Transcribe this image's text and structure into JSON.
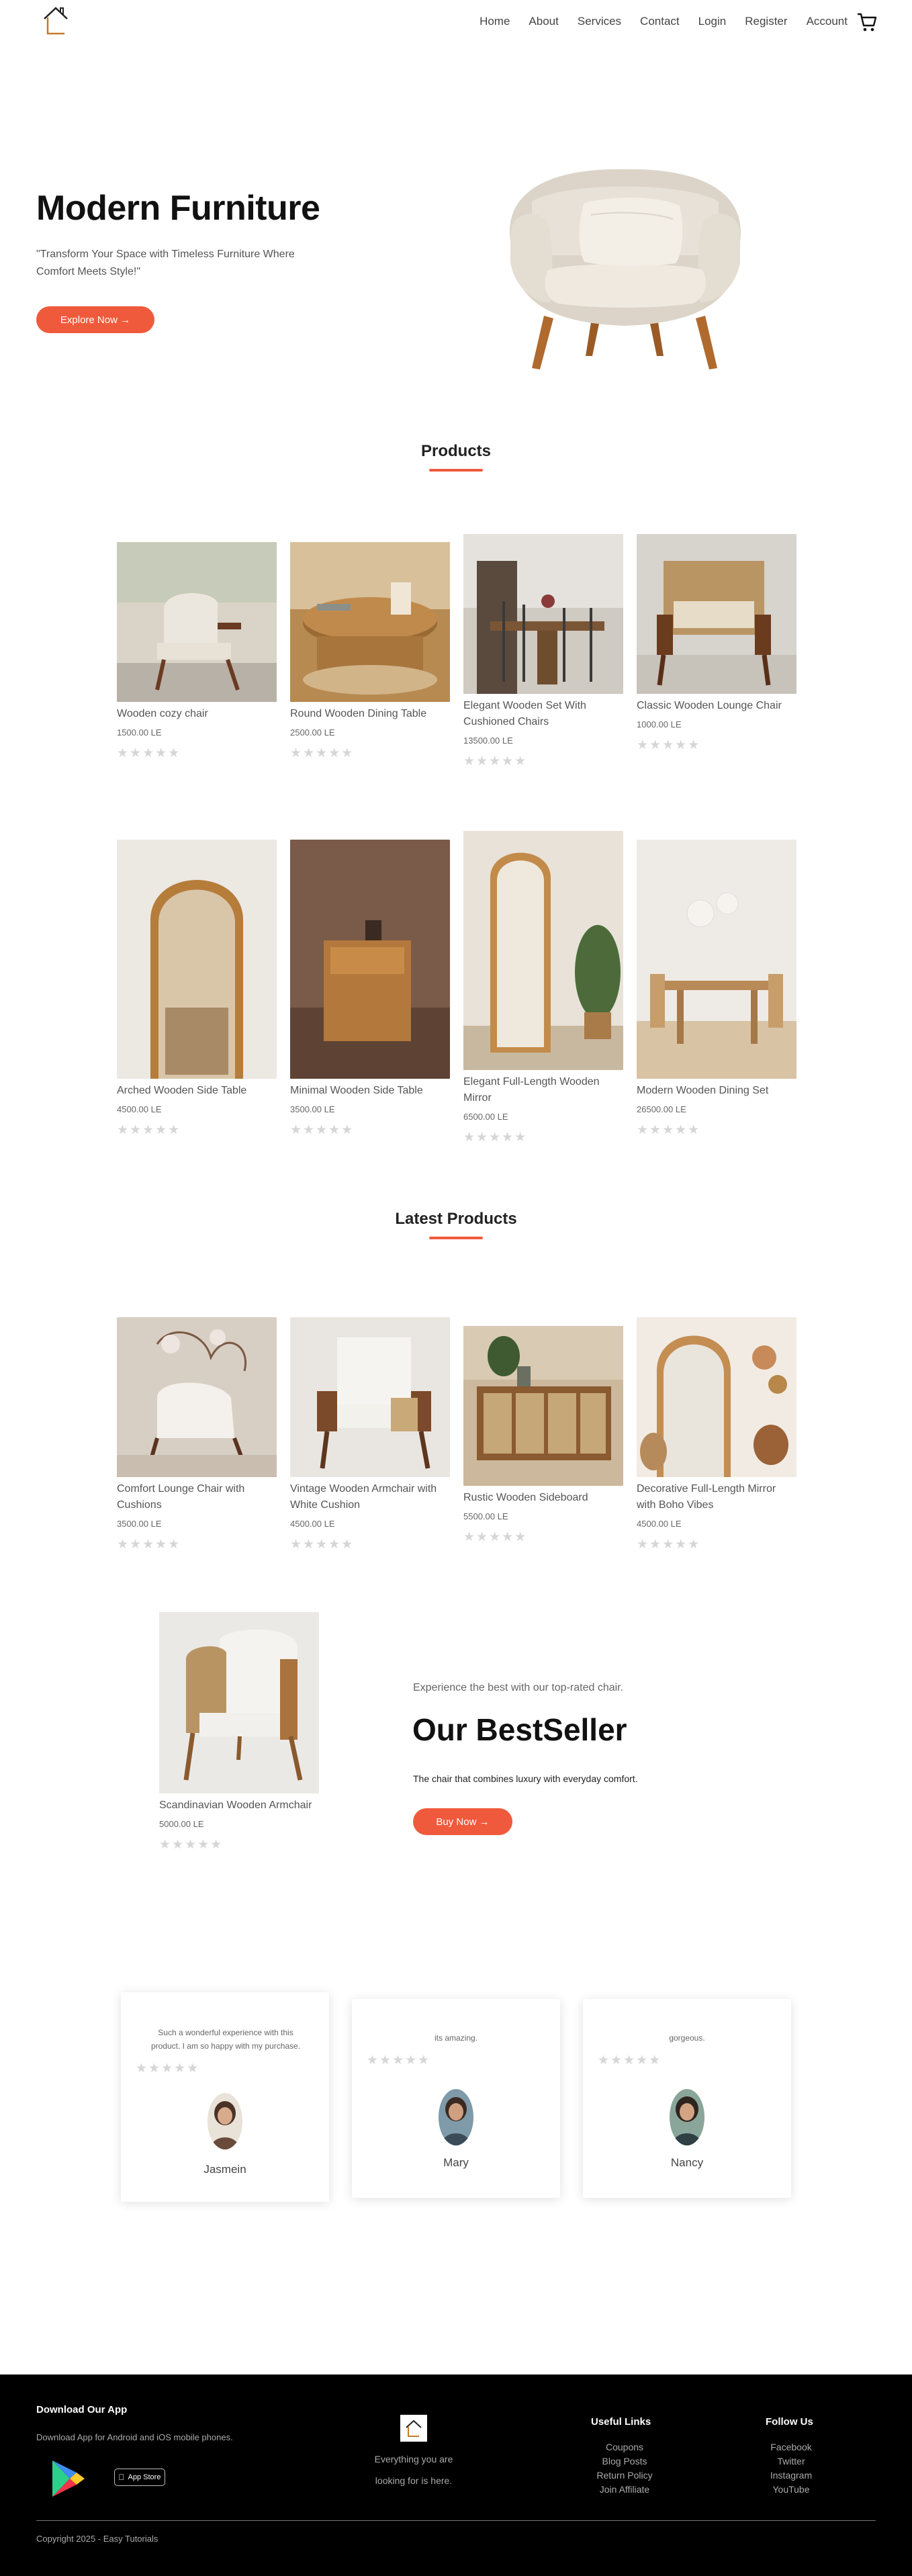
{
  "nav": {
    "items": [
      "Home",
      "About",
      "Services",
      "Contact",
      "Login",
      "Register",
      "Account"
    ],
    "logo_icon": "house-logo-icon",
    "cart_icon": "cart-icon"
  },
  "hero": {
    "title": "Modern Furniture",
    "subtitle": "\"Transform Your Space with Timeless Furniture Where Comfort Meets Style!\"",
    "button": "Explore Now →"
  },
  "products_section": {
    "title": "Products"
  },
  "products": [
    {
      "name": "Wooden cozy chair",
      "price": "1500.00 LE"
    },
    {
      "name": "Round Wooden Dining Table",
      "price": "2500.00 LE"
    },
    {
      "name": "Elegant Wooden Set With Cushioned Chairs",
      "price": "13500.00 LE"
    },
    {
      "name": "Classic Wooden Lounge Chair",
      "price": "1000.00 LE"
    },
    {
      "name": "Arched Wooden Side Table",
      "price": "4500.00 LE"
    },
    {
      "name": "Minimal Wooden Side Table",
      "price": "3500.00 LE"
    },
    {
      "name": "Elegant Full-Length Wooden Mirror",
      "price": "6500.00 LE"
    },
    {
      "name": "Modern Wooden Dining Set",
      "price": "26500.00 LE"
    }
  ],
  "latest_section": {
    "title": "Latest Products"
  },
  "latest": [
    {
      "name": "Comfort Lounge Chair with Cushions",
      "price": "3500.00 LE"
    },
    {
      "name": "Vintage Wooden Armchair with White Cushion",
      "price": "4500.00 LE"
    },
    {
      "name": "Rustic Wooden Sideboard",
      "price": "5500.00 LE"
    },
    {
      "name": "Decorative Full-Length Mirror with Boho Vibes",
      "price": "4500.00 LE"
    }
  ],
  "bestseller": {
    "product_name": "Scandinavian Wooden Armchair",
    "price": "5000.00 LE",
    "tagline": "Experience the best with our top-rated chair.",
    "title": "Our BestSeller",
    "description": "The chair that combines luxury with everyday comfort.",
    "button": "Buy Now →"
  },
  "stars": "★★★★★",
  "reviews": [
    {
      "text": "Such a wonderful experience with this product. I am so happy with my purchase.",
      "name": "Jasmein"
    },
    {
      "text": "its amazing.",
      "name": "Mary"
    },
    {
      "text": "gorgeous.",
      "name": "Nancy"
    }
  ],
  "footer": {
    "download_title": "Download Our App",
    "download_text": "Download App for Android and iOS mobile phones.",
    "tagline_1": "Everything you are",
    "tagline_2": "looking for is here.",
    "useful_title": "Useful Links",
    "useful_links": [
      "Coupons",
      "Blog Posts",
      "Return Policy",
      "Join Affiliate"
    ],
    "follow_title": "Follow Us",
    "follow_links": [
      "Facebook",
      "Twitter",
      "Instagram",
      "YouTube"
    ],
    "copyright": "Copyright 2025 - Easy Tutorials",
    "app_store_label": "App Store"
  },
  "colors": {
    "accent": "#f05a3c",
    "footer_bg": "#000000"
  }
}
